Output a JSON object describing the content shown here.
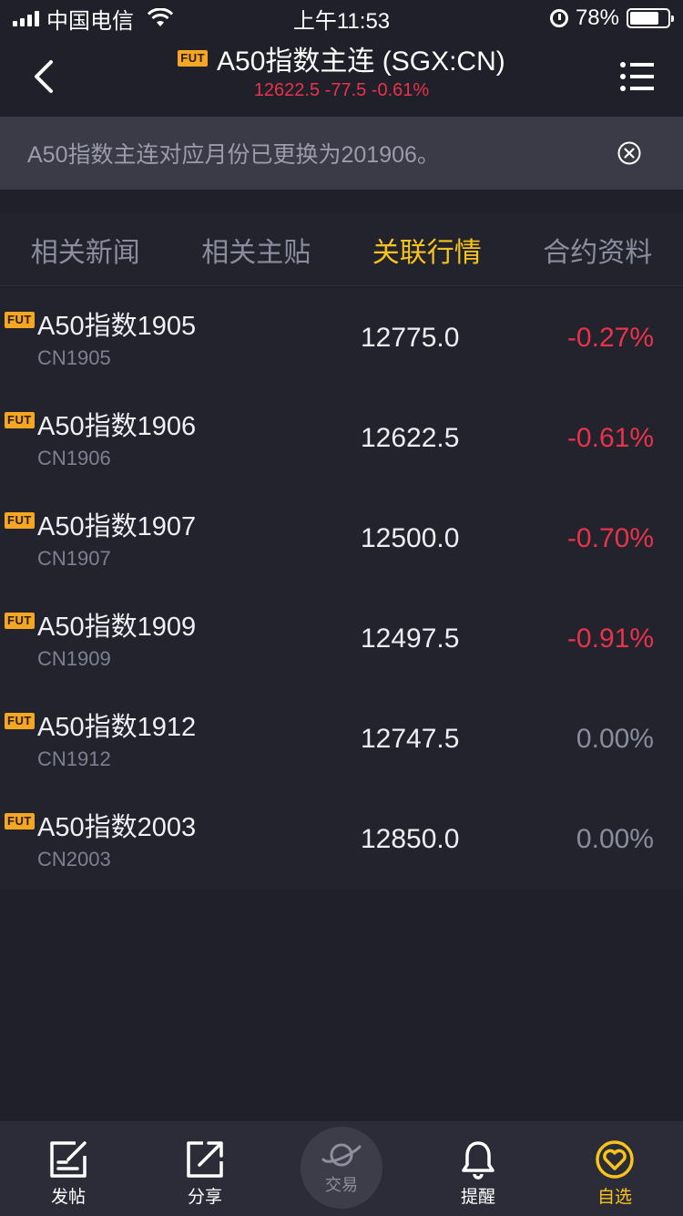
{
  "status_bar": {
    "carrier": "中国电信",
    "time": "上午11:53",
    "battery": "78%",
    "battery_level": 0.78
  },
  "header": {
    "badge": "FUT",
    "title": "A50指数主连 (SGX:CN)",
    "subtitle": "12622.5 -77.5 -0.61%"
  },
  "notice": {
    "text": "A50指数主连对应月份已更换为201906。"
  },
  "tabs": [
    {
      "label": "相关新闻"
    },
    {
      "label": "相关主贴"
    },
    {
      "label": "关联行情"
    },
    {
      "label": "合约资料"
    }
  ],
  "contracts": [
    {
      "badge": "FUT",
      "name": "A50指数1905",
      "code": "CN1905",
      "price": "12775.0",
      "change": "-0.27%"
    },
    {
      "badge": "FUT",
      "name": "A50指数1906",
      "code": "CN1906",
      "price": "12622.5",
      "change": "-0.61%"
    },
    {
      "badge": "FUT",
      "name": "A50指数1907",
      "code": "CN1907",
      "price": "12500.0",
      "change": "-0.70%"
    },
    {
      "badge": "FUT",
      "name": "A50指数1909",
      "code": "CN1909",
      "price": "12497.5",
      "change": "-0.91%"
    },
    {
      "badge": "FUT",
      "name": "A50指数1912",
      "code": "CN1912",
      "price": "12747.5",
      "change": "0.00%"
    },
    {
      "badge": "FUT",
      "name": "A50指数2003",
      "code": "CN2003",
      "price": "12850.0",
      "change": "0.00%"
    }
  ],
  "tabbar": {
    "post": "发帖",
    "share": "分享",
    "trade": "交易",
    "alert": "提醒",
    "watchlist": "自选"
  },
  "colors": {
    "accent": "#f7c31c",
    "negative": "#e8334a",
    "neutral": "#8a8d9e",
    "background": "#1f2029"
  }
}
